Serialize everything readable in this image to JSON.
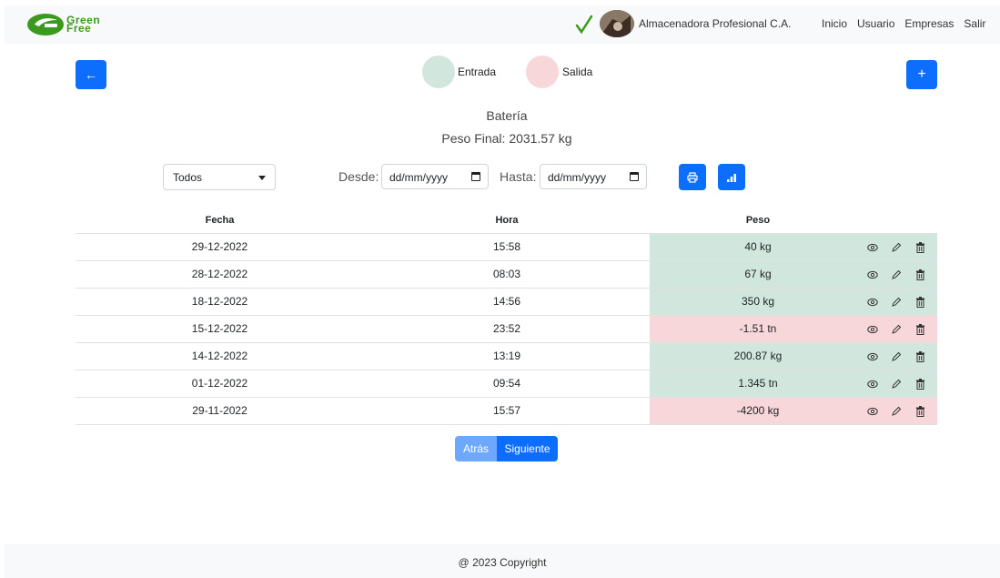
{
  "navbar": {
    "brand_text": "Green Free",
    "company": "Almacenadora Profesional C.A.",
    "links": [
      "Inicio",
      "Usuario",
      "Empresas",
      "Salir"
    ]
  },
  "legend": {
    "entrada": "Entrada",
    "salida": "Salida",
    "entrada_color": "#d1e7dd",
    "salida_color": "#f8d7da"
  },
  "header": {
    "title": "Batería",
    "subtitle": "Peso Final: 2031.57 kg"
  },
  "filters": {
    "type_selected": "Todos",
    "desde_label": "Desde:",
    "hasta_label": "Hasta:",
    "desde_value": "dd/mm/yyyy",
    "hasta_value": "dd/mm/yyyy"
  },
  "table": {
    "headers": [
      "Fecha",
      "Hora",
      "Peso"
    ],
    "rows": [
      {
        "fecha": "29-12-2022",
        "hora": "15:58",
        "peso": "40 kg",
        "tipo": "entrada"
      },
      {
        "fecha": "28-12-2022",
        "hora": "08:03",
        "peso": "67 kg",
        "tipo": "entrada"
      },
      {
        "fecha": "18-12-2022",
        "hora": "14:56",
        "peso": "350 kg",
        "tipo": "entrada"
      },
      {
        "fecha": "15-12-2022",
        "hora": "23:52",
        "peso": "-1.51 tn",
        "tipo": "salida"
      },
      {
        "fecha": "14-12-2022",
        "hora": "13:19",
        "peso": "200.87 kg",
        "tipo": "entrada"
      },
      {
        "fecha": "01-12-2022",
        "hora": "09:54",
        "peso": "1.345 tn",
        "tipo": "entrada"
      },
      {
        "fecha": "29-11-2022",
        "hora": "15:57",
        "peso": "-4200 kg",
        "tipo": "salida"
      }
    ]
  },
  "pagination": {
    "prev": "Atrás",
    "next": "Siguiente"
  },
  "footer": {
    "text": "@ 2023 Copyright"
  },
  "colors": {
    "primary": "#0d6efd",
    "brand_green": "#3b9a1d"
  }
}
